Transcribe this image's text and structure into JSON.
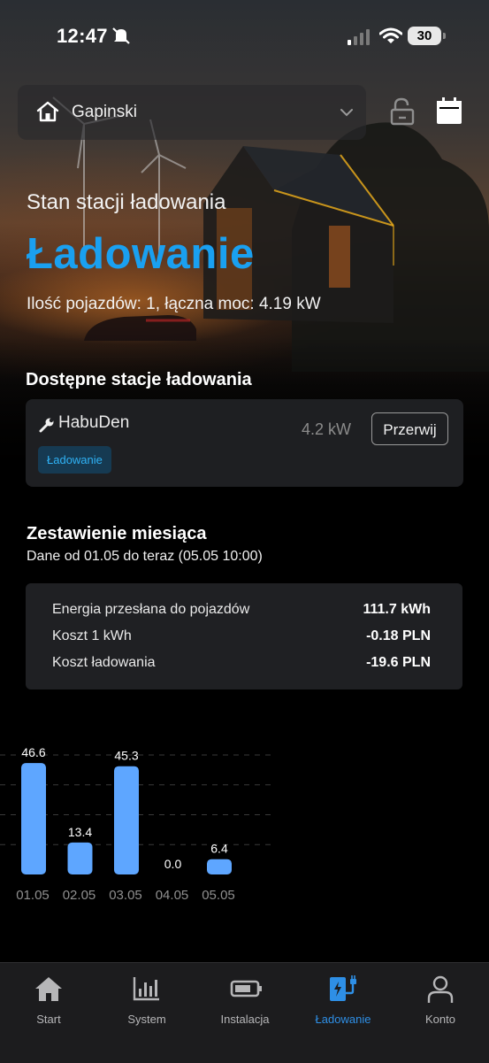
{
  "status_bar": {
    "time": "12:47",
    "battery": "30"
  },
  "header": {
    "location": "Gapinski",
    "icons": [
      "home-icon",
      "chevron-down-icon",
      "unlock-icon",
      "calendar-icon"
    ]
  },
  "hero": {
    "status_label": "Stan stacji ładowania",
    "status_value": "Ładowanie",
    "summary": "Ilość pojazdów: 1, łączna moc: 4.19 kW"
  },
  "stations": {
    "title": "Dostępne stacje ładowania",
    "items": [
      {
        "name": "HabuDen",
        "power": "4.2 kW",
        "action": "Przerwij",
        "badge": "Ładowanie"
      }
    ]
  },
  "month": {
    "title": "Zestawienie miesiąca",
    "date_range": "Dane od 01.05 do teraz (05.05 10:00)",
    "rows": [
      {
        "label": "Energia przesłana do pojazdów",
        "value": "111.7 kWh"
      },
      {
        "label": "Koszt 1 kWh",
        "value": "-0.18 PLN"
      },
      {
        "label": "Koszt ładowania",
        "value": "-19.6 PLN"
      }
    ]
  },
  "chart_data": {
    "type": "bar",
    "categories": [
      "01.05",
      "02.05",
      "03.05",
      "04.05",
      "05.05"
    ],
    "values": [
      46.6,
      13.4,
      45.3,
      0.0,
      6.4
    ],
    "value_labels": [
      "46.6",
      "13.4",
      "45.3",
      "0.0",
      "6.4"
    ],
    "ylim": [
      0,
      50
    ],
    "grid": true,
    "bar_color": "#5ea6ff"
  },
  "tabs": [
    {
      "label": "Start",
      "icon": "home-icon",
      "active": false
    },
    {
      "label": "System",
      "icon": "bar-chart-icon",
      "active": false
    },
    {
      "label": "Instalacja",
      "icon": "battery-icon",
      "active": false
    },
    {
      "label": "Ładowanie",
      "icon": "ev-charger-icon",
      "active": true
    },
    {
      "label": "Konto",
      "icon": "user-icon",
      "active": false
    }
  ],
  "colors": {
    "accent": "#1aa0f0",
    "active_tab": "#2e8fe6",
    "bar": "#5ea6ff",
    "badge_text": "#2fb2f5",
    "badge_bg": "#163a52"
  }
}
